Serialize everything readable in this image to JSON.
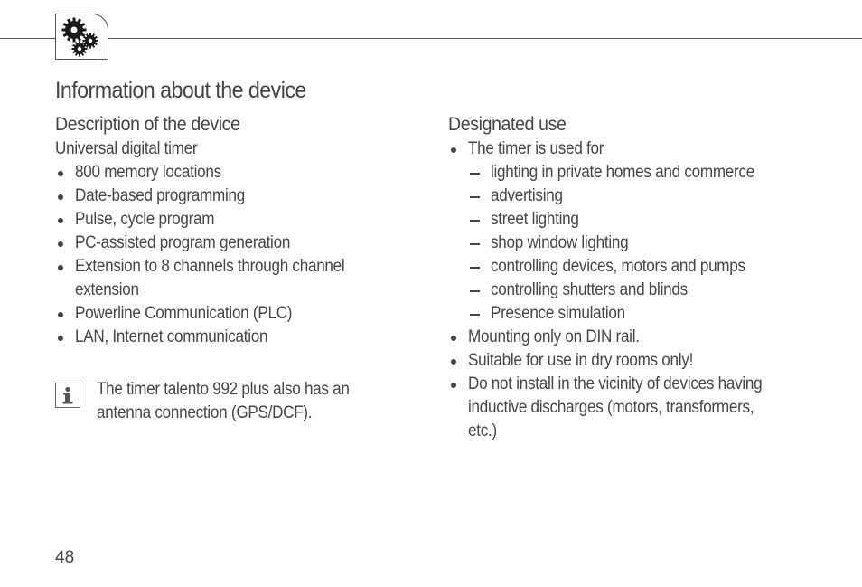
{
  "header": {
    "icon": "gears-icon"
  },
  "page_title": "Information about the device",
  "left": {
    "heading": "Description of the device",
    "subtitle": "Universal digital timer",
    "items": [
      {
        "text": "800 memory locations"
      },
      {
        "text": "Date-based programming"
      },
      {
        "text": "Pulse, cycle program"
      },
      {
        "text": "PC-assisted program generation"
      },
      {
        "text": "Extension to 8 channels through channel",
        "text2": "extension"
      },
      {
        "text": "Powerline Communication (PLC)"
      },
      {
        "text": "LAN, Internet communication"
      }
    ],
    "note": {
      "icon": "info-icon",
      "line1": "The timer talento 992 plus also has an",
      "line2": "antenna connection (GPS/DCF)."
    }
  },
  "right": {
    "heading": "Designated use",
    "items": [
      {
        "type": "bullet",
        "text": "The timer is used for"
      },
      {
        "type": "dash",
        "text": "lighting in private homes and commerce"
      },
      {
        "type": "dash",
        "text": "advertising"
      },
      {
        "type": "dash",
        "text": "street lighting"
      },
      {
        "type": "dash",
        "text": "shop window lighting"
      },
      {
        "type": "dash",
        "text": "controlling devices, motors and pumps"
      },
      {
        "type": "dash",
        "text": "controlling shutters and blinds"
      },
      {
        "type": "dash",
        "text": "Presence simulation"
      },
      {
        "type": "bullet",
        "text": "Mounting only on DIN rail."
      },
      {
        "type": "bullet",
        "text": "Suitable for use in dry rooms only!"
      },
      {
        "type": "bullet",
        "text": "Do not install in the vicinity of devices having",
        "text2": "inductive discharges (motors, transformers,",
        "text3": "etc.)"
      }
    ]
  },
  "footer": {
    "page_number": "48"
  }
}
